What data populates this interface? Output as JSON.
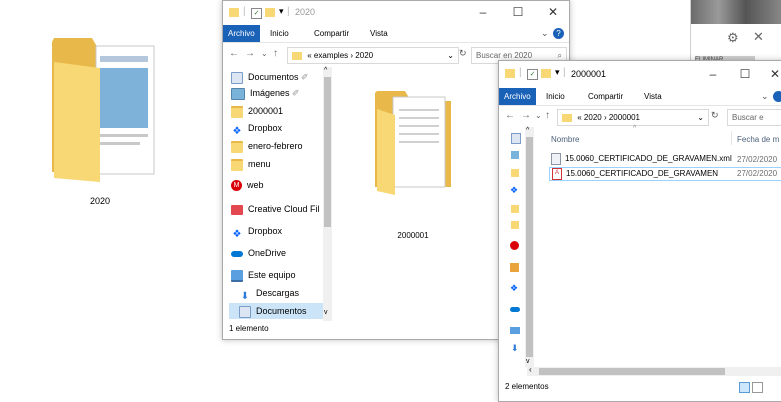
{
  "desktop": {
    "folder_label": "2020"
  },
  "background_window": {
    "partial_label": "ELIMINAR"
  },
  "window1": {
    "title": "2020",
    "ribbon_tabs": [
      "Archivo",
      "Inicio",
      "Compartir",
      "Vista"
    ],
    "address": {
      "prefix": "«",
      "crumbs": [
        "examples",
        "2020"
      ]
    },
    "search_placeholder": "Buscar en 2020",
    "nav_items": [
      "Documentos",
      "Imágenes",
      "2000001",
      "Dropbox",
      "enero-febrero",
      "menu",
      "web",
      "Creative Cloud Fil",
      "Dropbox",
      "OneDrive",
      "Este equipo",
      "Descargas",
      "Documentos"
    ],
    "content_folder_label": "2000001",
    "status": "1 elemento"
  },
  "window2": {
    "title": "2000001",
    "ribbon_tabs": [
      "Archivo",
      "Inicio",
      "Compartir",
      "Vista"
    ],
    "address": {
      "prefix": "«",
      "crumbs": [
        "2020",
        "2000001"
      ]
    },
    "search_placeholder": "Buscar e",
    "columns": {
      "name": "Nombre",
      "date": "Fecha de m"
    },
    "files": [
      {
        "name": "15.0060_CERTIFICADO_DE_GRAVAMEN.xml",
        "date": "27/02/2020",
        "type": "xml"
      },
      {
        "name": "15.0060_CERTIFICADO_DE_GRAVAMEN",
        "date": "27/02/2020",
        "type": "pdf"
      }
    ],
    "status": "2 elementos"
  },
  "colors": {
    "accent": "#1a61b8",
    "folder": "#f8d775",
    "selection": "#cce4f7"
  }
}
